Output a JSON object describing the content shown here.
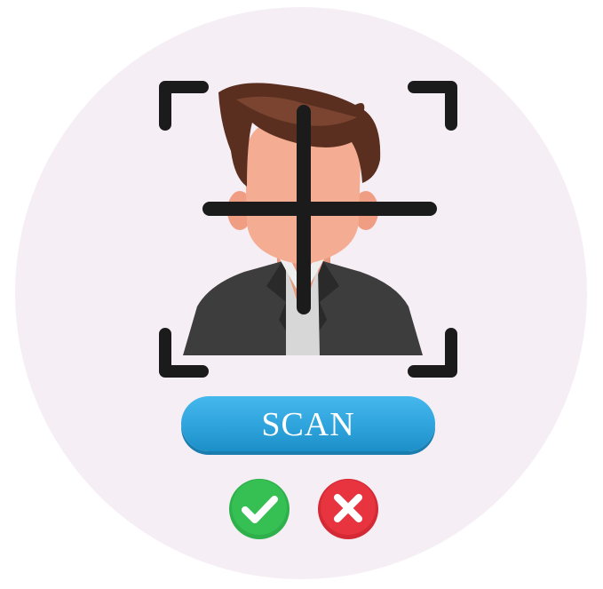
{
  "scan_button": {
    "label": "SCAN",
    "color": "#2ea3dc"
  },
  "icons": {
    "avatar": "person-avatar-icon",
    "viewfinder": "viewfinder-corners-icon",
    "crosshair": "crosshair-icon",
    "approve": "checkmark-icon",
    "reject": "x-mark-icon"
  },
  "colors": {
    "background_circle": "#f6eef5",
    "approve": "#2eb04a",
    "reject": "#e8343f",
    "frame": "#1b1b1b",
    "hair": "#5a2f20",
    "skin": "#f4ac93",
    "suit": "#3d3d3d",
    "shirt": "#d7d7d7"
  }
}
